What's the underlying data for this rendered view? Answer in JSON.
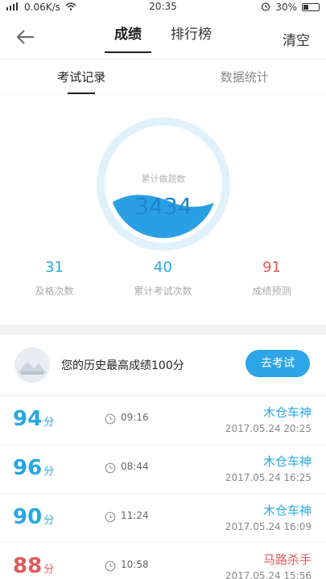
{
  "status_bar": {
    "left": "0.06K/s",
    "time": "20:35",
    "battery": "30%"
  },
  "topbar": {
    "tabs": [
      {
        "label": "成绩",
        "active": true
      },
      {
        "label": "排行榜",
        "active": false
      }
    ],
    "clear_label": "清空"
  },
  "subtabs": [
    {
      "label": "考试记录",
      "active": true
    },
    {
      "label": "数据统计",
      "active": false
    }
  ],
  "gauge": {
    "label": "累计做题数",
    "value": "3434"
  },
  "stats": [
    {
      "value": "31",
      "label": "及格次数",
      "color": "#29a8e0"
    },
    {
      "value": "40",
      "label": "累计考试次数",
      "color": "#29a8e0"
    },
    {
      "value": "91",
      "label": "成绩预测",
      "color": "#e65a5a"
    }
  ],
  "best": {
    "text": "您的历史最高成绩100分",
    "button": "去考试"
  },
  "records": [
    {
      "score": "94",
      "unit": "分",
      "duration": "09:16",
      "nick": "木仓车神",
      "date": "2017.05.24  20:25",
      "color": "#27a7e1"
    },
    {
      "score": "96",
      "unit": "分",
      "duration": "08:44",
      "nick": "木仓车神",
      "date": "2017.05.24  16:25",
      "color": "#27a7e1"
    },
    {
      "score": "90",
      "unit": "分",
      "duration": "11:24",
      "nick": "木仓车神",
      "date": "2017.05.24  16:09",
      "color": "#27a7e1"
    },
    {
      "score": "88",
      "unit": "分",
      "duration": "10:58",
      "nick": "马路杀手",
      "date": "2017.05.24  15:56",
      "color": "#e05a5a"
    }
  ]
}
